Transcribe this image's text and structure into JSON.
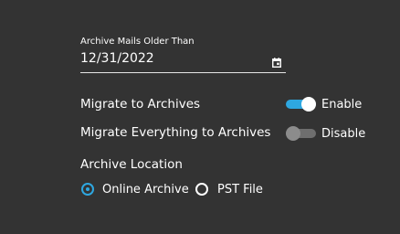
{
  "archive_date": {
    "label": "Archive Mails Older Than",
    "value": "12/31/2022",
    "icon": "calendar-icon"
  },
  "settings": [
    {
      "label": "Migrate to Archives",
      "state_label": "Enable",
      "on": true
    },
    {
      "label": "Migrate Everything to Archives",
      "state_label": "Disable",
      "on": false
    }
  ],
  "archive_location": {
    "title": "Archive Location",
    "options": [
      {
        "label": "Online Archive",
        "selected": true
      },
      {
        "label": "PST File",
        "selected": false
      }
    ]
  },
  "colors": {
    "background": "#333333",
    "accent": "#2ea7e0",
    "toggle_off": "#6e6e6e"
  }
}
